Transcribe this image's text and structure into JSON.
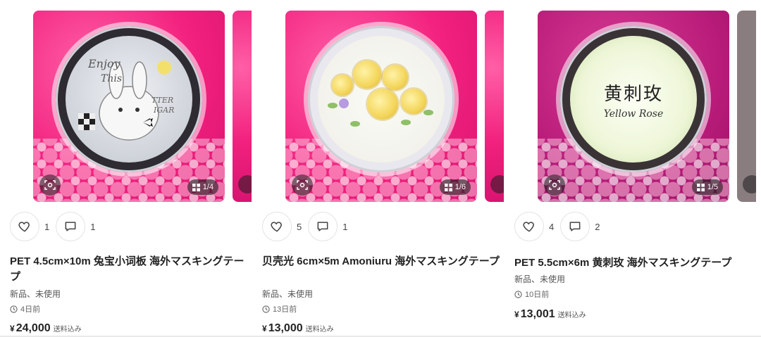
{
  "cards": [
    {
      "image_counter": "1/4",
      "likes": "1",
      "comments": "1",
      "title": "PET 4.5cm×10m 兔宝小词板 海外マスキングテープ",
      "condition": "新品、未使用",
      "posted": "4日前",
      "price_symbol": "¥",
      "price": "24,000",
      "shipping": "送料込み"
    },
    {
      "image_counter": "1/6",
      "likes": "5",
      "comments": "1",
      "title": "贝壳光 6cm×5m Amoniuru 海外マスキングテープ",
      "condition": "新品、未使用",
      "posted": "13日前",
      "price_symbol": "¥",
      "price": "13,000",
      "shipping": "送料込み"
    },
    {
      "image_counter": "1/5",
      "likes": "4",
      "comments": "2",
      "title": "PET 5.5cm×6m 黄刺玫 海外マスキングテープ",
      "condition": "新品、未使用",
      "posted": "10日前",
      "price_symbol": "¥",
      "price": "13,001",
      "shipping": "送料込み",
      "tape_text_cn": "黄刺玫",
      "tape_text_en": "Yellow Rose"
    }
  ],
  "colors": {
    "pink_bg": "#f2207e",
    "magenta_bg": "#b81b79",
    "text": "#222222"
  },
  "icons": [
    "scan-icon",
    "gallery-icon",
    "heart-icon",
    "comment-icon",
    "clock-icon"
  ]
}
